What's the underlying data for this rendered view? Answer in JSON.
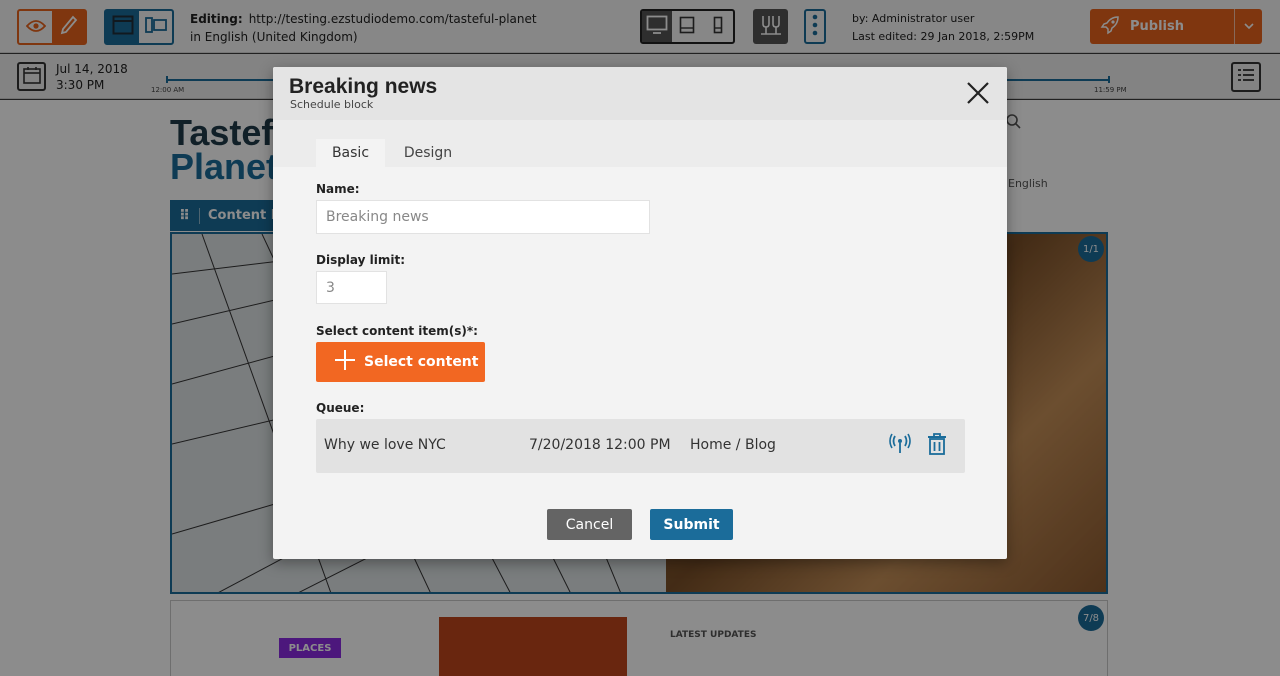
{
  "topbar": {
    "editing_label": "Editing:",
    "editing_url": "http://testing.ezstudiodemo.com/tasteful-planet",
    "editing_language": "in English (United Kingdom)",
    "user_line": "by: Administrator user",
    "last_edited": "Last edited: 29 Jan 2018, 2:59PM",
    "publish_label": "Publish"
  },
  "timeline": {
    "date": "Jul 14, 2018",
    "time": "3:30 PM",
    "start_label": "12:00 AM",
    "end_label": "11:59 PM"
  },
  "page": {
    "title_line1": "Tastef",
    "title_line2": "Planet",
    "block_label": "Content L",
    "hero_badge": "1/1",
    "tag_places": "PLACES",
    "latest_updates": "LATEST UPDATES",
    "language": "English",
    "lower_badge": "7/8"
  },
  "modal": {
    "title": "Breaking news",
    "subtitle": "Schedule block",
    "tabs": [
      "Basic",
      "Design"
    ],
    "name_label": "Name:",
    "name_placeholder": "Breaking news",
    "limit_label": "Display limit:",
    "limit_placeholder": "3",
    "select_label": "Select content item(s)*:",
    "select_button": "Select content",
    "queue_label": "Queue:",
    "queue": [
      {
        "title": "Why we love NYC",
        "date": "7/20/2018 12:00 PM",
        "location": "Home / Blog"
      }
    ],
    "cancel_label": "Cancel",
    "submit_label": "Submit"
  },
  "colors": {
    "accent_orange": "#e8631c",
    "accent_blue": "#1b6c9a"
  },
  "icons": [
    "eye-icon",
    "pencil-icon",
    "browser-window-icon",
    "split-view-icon",
    "desktop-icon",
    "tablet-icon",
    "phone-icon",
    "preview-icon",
    "more-icon",
    "rocket-icon",
    "chevron-down-icon",
    "calendar-icon",
    "list-icon",
    "close-icon",
    "plus-icon",
    "broadcast-icon",
    "trash-icon",
    "grip-icon"
  ]
}
